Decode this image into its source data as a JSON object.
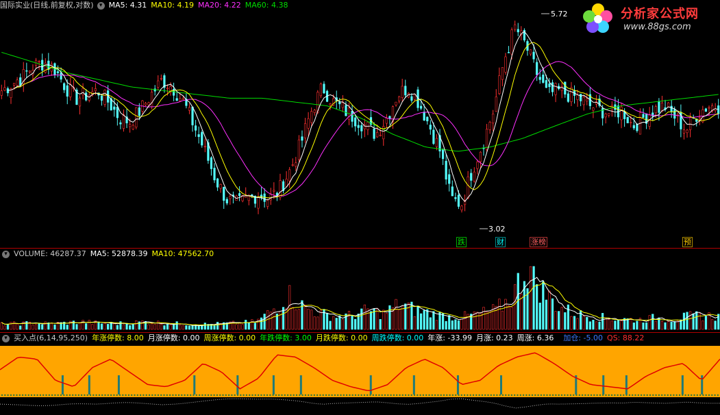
{
  "header": {
    "title": "国际实业(日线,前复权,对数)",
    "ma5": "MA5: 4.31",
    "ma10": "MA10: 4.19",
    "ma20": "MA20: 4.22",
    "ma60": "MA60: 4.38"
  },
  "volume_bar": {
    "volume": "VOLUME: 46287.37",
    "ma5": "MA5: 52878.39",
    "ma10": "MA10: 47562.70"
  },
  "indicator_bar": {
    "name": "买入点(6,14,95,250)",
    "items": [
      {
        "label": "年涨停数: 8.00",
        "color": "#ffff00"
      },
      {
        "label": "月涨停数: 0.00",
        "color": "#ffffff"
      },
      {
        "label": "周涨停数: 0.00",
        "color": "#ffff00"
      },
      {
        "label": "年跌停数: 3.00",
        "color": "#00ff00"
      },
      {
        "label": "月跌停数: 0.00",
        "color": "#ffff00"
      },
      {
        "label": "周跌停数: 0.00",
        "color": "#00ffff"
      },
      {
        "label": "年涨: -33.99",
        "color": "#ffffff"
      },
      {
        "label": "月涨: 0.23",
        "color": "#ffffff"
      },
      {
        "label": "周涨: 6.36",
        "color": "#ffffff"
      },
      {
        "label": "加仓: -5.00",
        "color": "#3c78ff"
      },
      {
        "label": "QS: 88.22",
        "color": "#ff3030"
      }
    ]
  },
  "logo": {
    "title": "分析家公式网",
    "url": "www.88gs.com"
  },
  "annotations": {
    "high": "5.72",
    "low": "3.02"
  },
  "events": [
    {
      "label": "跌",
      "color": "#00dd00",
      "border": "#00aa00"
    },
    {
      "label": "财",
      "color": "#00ffff",
      "border": "#008888"
    },
    {
      "label": "涨榜",
      "color": "#ff6060",
      "border": "#aa3030"
    },
    {
      "label": "预",
      "color": "#ffcc00",
      "border": "#aa8800"
    }
  ],
  "colors": {
    "up": "#ff3030",
    "down": "#54fcfc",
    "ma5": "#ffffff",
    "ma10": "#ffff00",
    "ma20": "#ff30ff",
    "ma60": "#00dd00",
    "panel": "#ffa500",
    "signal": "#e00000"
  },
  "chart_data": {
    "type": "candlestick",
    "y_axis": "log",
    "high": 5.72,
    "low": 3.02,
    "close_path": [
      4.55,
      4.65,
      4.75,
      4.9,
      4.95,
      4.85,
      4.6,
      4.45,
      4.5,
      4.55,
      4.4,
      4.2,
      4.15,
      4.3,
      4.5,
      4.7,
      4.6,
      4.4,
      4.1,
      3.8,
      3.5,
      3.3,
      3.25,
      3.3,
      3.35,
      3.3,
      3.4,
      3.6,
      3.9,
      4.3,
      4.6,
      4.4,
      4.3,
      4.2,
      4.1,
      4.0,
      4.2,
      4.5,
      4.6,
      4.4,
      4.1,
      3.8,
      3.3,
      3.25,
      3.6,
      3.9,
      4.3,
      5.0,
      5.5,
      5.2,
      4.8,
      4.5,
      4.55,
      4.5,
      4.45,
      4.35,
      4.3,
      4.25,
      4.3,
      4.1,
      4.2,
      4.3,
      4.35,
      4.2,
      4.05,
      4.25,
      4.35,
      4.35
    ],
    "ma60_path": [
      5.1,
      4.95,
      4.8,
      4.7,
      4.6,
      4.55,
      4.5,
      4.45,
      4.45,
      4.4,
      4.35,
      4.2,
      4.0,
      3.85,
      3.8,
      3.85,
      3.95,
      4.1,
      4.25,
      4.35,
      4.4,
      4.45,
      4.5
    ],
    "volume_path": [
      0.08,
      0.09,
      0.1,
      0.09,
      0.1,
      0.12,
      0.1,
      0.09,
      0.1,
      0.12,
      0.1,
      0.09,
      0.08,
      0.08,
      0.09,
      0.1,
      0.12,
      0.3,
      0.55,
      0.35,
      0.25,
      0.2,
      0.22,
      0.3,
      0.25,
      0.4,
      0.3,
      0.25,
      0.2,
      0.2,
      0.25,
      0.3,
      0.5,
      1.0,
      0.6,
      0.35,
      0.25,
      0.2,
      0.18,
      0.16,
      0.15,
      0.18,
      0.16,
      0.2,
      0.22,
      0.2
    ],
    "indicator_path": [
      0.55,
      0.85,
      0.8,
      0.3,
      0.15,
      0.6,
      0.8,
      0.5,
      0.2,
      0.15,
      0.3,
      0.7,
      0.5,
      0.1,
      0.35,
      0.9,
      0.85,
      0.6,
      0.3,
      0.15,
      0.05,
      0.2,
      0.6,
      0.8,
      0.6,
      0.2,
      0.3,
      0.65,
      0.85,
      0.95,
      0.7,
      0.4,
      0.2,
      0.15,
      0.1,
      0.4,
      0.6,
      0.7,
      0.3,
      0.8
    ],
    "signal_positions": [
      0.087,
      0.124,
      0.165,
      0.27,
      0.33,
      0.38,
      0.418,
      0.515,
      0.575,
      0.636,
      0.696,
      0.8,
      0.838,
      0.87,
      0.948,
      0.975
    ]
  }
}
